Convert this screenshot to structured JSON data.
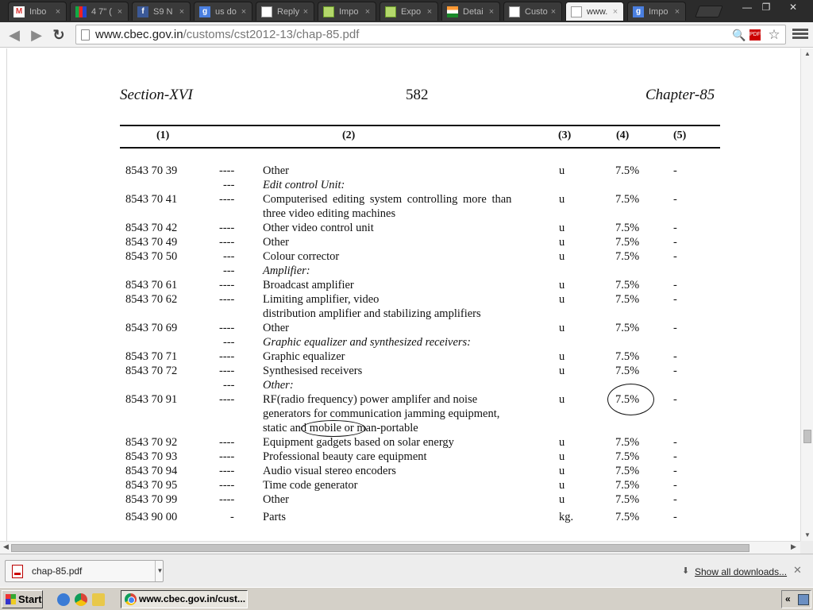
{
  "window": {
    "minimize_glyph": "—",
    "restore_glyph": "❐",
    "close_glyph": "✕"
  },
  "tabs": [
    {
      "label": "Inbo",
      "icon": "gmail-icon",
      "close": "×"
    },
    {
      "label": "4 7\" (",
      "icon": "shop-icon",
      "close": "×"
    },
    {
      "label": "S9 N",
      "icon": "facebook-icon",
      "close": "×"
    },
    {
      "label": "us do",
      "icon": "google-icon",
      "close": "×"
    },
    {
      "label": "Reply",
      "icon": "page-icon",
      "close": "×"
    },
    {
      "label": "Impo",
      "icon": "sheets-icon",
      "close": "×"
    },
    {
      "label": "Expo",
      "icon": "sheets-icon",
      "close": "×"
    },
    {
      "label": "Detai",
      "icon": "india-flag-icon",
      "close": "×"
    },
    {
      "label": "Custo",
      "icon": "page-icon",
      "close": "×"
    },
    {
      "label": "www.",
      "icon": "page-icon",
      "close": "×",
      "active": true
    },
    {
      "label": "Impo",
      "icon": "google-icon",
      "close": "×"
    }
  ],
  "toolbar": {
    "back_glyph": "◀",
    "forward_glyph": "▶",
    "reload_glyph": "↻",
    "url_host": "www.cbec.gov.in",
    "url_path": "/customs/cst2012-13/chap-85.pdf",
    "zoom_glyph": "🔍",
    "pdf_badge": "PDF",
    "star_glyph": "☆"
  },
  "document": {
    "header_left": "Section-XVI",
    "header_center": "582",
    "header_right": "Chapter-85",
    "columns": [
      "(1)",
      "(2)",
      "(3)",
      "(4)",
      "(5)"
    ],
    "rows": [
      {
        "code": "8543 70 39",
        "dash": "----",
        "desc": [
          "Other"
        ],
        "unit": "u",
        "rate": "7.5%",
        "col5": "-"
      },
      {
        "code": "",
        "dash": "---",
        "desc": [
          "Edit control Unit:"
        ],
        "unit": "",
        "rate": "",
        "col5": "",
        "italic": true
      },
      {
        "code": "8543 70 41",
        "dash": "----",
        "desc": [
          "Computerised editing system controlling more than",
          "three video editing machines"
        ],
        "unit": " u",
        "rate": "7.5%",
        "col5": "-"
      },
      {
        "code": "8543 70 42",
        "dash": "----",
        "desc": [
          "Other video control unit"
        ],
        "unit": "u",
        "rate": "7.5%",
        "col5": "-"
      },
      {
        "code": "8543 70 49",
        "dash": "----",
        "desc": [
          "Other"
        ],
        "unit": "u",
        "rate": "7.5%",
        "col5": "-"
      },
      {
        "code": "8543 70 50",
        "dash": "---",
        "desc": [
          "Colour corrector"
        ],
        "unit": "u",
        "rate": "7.5%",
        "col5": "-"
      },
      {
        "code": "",
        "dash": "---",
        "desc": [
          "Amplifier:"
        ],
        "unit": "",
        "rate": "",
        "col5": "",
        "italic": true
      },
      {
        "code": "8543 70 61",
        "dash": "----",
        "desc": [
          "Broadcast amplifier"
        ],
        "unit": "u",
        "rate": "7.5%",
        "col5": "-"
      },
      {
        "code": "8543 70 62",
        "dash": "----",
        "desc": [
          "Limiting amplifier, video",
          "distribution amplifier and stabilizing amplifiers"
        ],
        "unit": "u",
        "rate": "7.5%",
        "col5": "-"
      },
      {
        "code": "8543 70 69",
        "dash": "----",
        "desc": [
          "Other"
        ],
        "unit": "u",
        "rate": "7.5%",
        "col5": "-"
      },
      {
        "code": "",
        "dash": "---",
        "desc": [
          "Graphic equalizer and synthesized  receivers:"
        ],
        "unit": "",
        "rate": "",
        "col5": "",
        "italic": true
      },
      {
        "code": "8543 70 71",
        "dash": "----",
        "desc": [
          "Graphic equalizer"
        ],
        "unit": "u",
        "rate": "7.5%",
        "col5": "-"
      },
      {
        "code": "8543 70 72",
        "dash": "----",
        "desc": [
          "Synthesised receivers"
        ],
        "unit": "u",
        "rate": "7.5%",
        "col5": "-"
      },
      {
        "code": "",
        "dash": "---",
        "desc": [
          "Other:"
        ],
        "unit": "",
        "rate": "",
        "col5": "",
        "italic": true
      },
      {
        "code": "8543 70 91",
        "dash": "----",
        "desc": [
          "RF(radio frequency) power amplifer and noise",
          "generators for communication jamming equipment,",
          "static and mobile or man-portable"
        ],
        "unit": "u",
        "rate": "7.5%",
        "col5": "-"
      },
      {
        "code": "8543 70 92",
        "dash": "----",
        "desc": [
          "Equipment gadgets based on solar energy"
        ],
        "unit": "u",
        "rate": "7.5%",
        "col5": "-"
      },
      {
        "code": "8543 70 93",
        "dash": "----",
        "desc": [
          "Professional beauty care equipment"
        ],
        "unit": "u",
        "rate": "7.5%",
        "col5": "-"
      },
      {
        "code": "8543 70 94",
        "dash": "----",
        "desc": [
          "Audio visual stereo encoders"
        ],
        "unit": "u",
        "rate": "7.5%",
        "col5": "-"
      },
      {
        "code": "8543 70 95",
        "dash": "----",
        "desc": [
          "Time code generator"
        ],
        "unit": "u",
        "rate": "7.5%",
        "col5": "-"
      },
      {
        "code": "8543 70 99",
        "dash": "----",
        "desc": [
          "Other"
        ],
        "unit": "u",
        "rate": "7.5%",
        "col5": "-"
      },
      {
        "code": "8543 90 00",
        "dash": "-",
        "desc": [
          "Parts"
        ],
        "unit": "kg.",
        "rate": "7.5%",
        "col5": "-"
      }
    ]
  },
  "downloads": {
    "item_name": "chap-85.pdf",
    "show_all": "Show all downloads...",
    "close_glyph": "✕"
  },
  "taskbar": {
    "start_label": "Start",
    "task_label": "www.cbec.gov.in/cust...",
    "tray_chevron": "«"
  }
}
